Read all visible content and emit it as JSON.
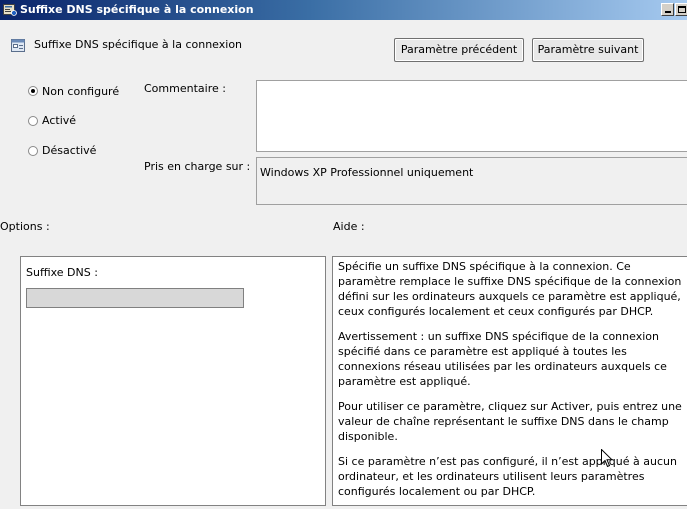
{
  "window": {
    "title": "Suffixe DNS spécifique à la connexion"
  },
  "header": {
    "setting_name": "Suffixe DNS spécifique à la connexion",
    "prev_button": "Paramètre précédent",
    "next_button": "Paramètre suivant"
  },
  "state": {
    "options": [
      {
        "label": "Non configuré",
        "checked": true
      },
      {
        "label": "Activé",
        "checked": false
      },
      {
        "label": "Désactivé",
        "checked": false
      }
    ]
  },
  "comment": {
    "label": "Commentaire :",
    "value": ""
  },
  "supported": {
    "label": "Pris en charge sur :",
    "value": "Windows XP Professionnel uniquement"
  },
  "options_section": {
    "label": "Options :",
    "field_label": "Suffixe DNS :",
    "field_value": ""
  },
  "help_section": {
    "label": "Aide :",
    "paragraphs": [
      "Spécifie un suffixe DNS spécifique à la connexion. Ce paramètre remplace le suffixe DNS spécifique de la connexion défini sur les ordinateurs auxquels ce paramètre est appliqué, ceux configurés localement et ceux configurés par DHCP.",
      "Avertissement : un suffixe DNS spécifique de la connexion spécifié dans ce paramètre est appliqué à toutes les connexions réseau utilisées par les ordinateurs auxquels ce paramètre est appliqué.",
      "Pour utiliser ce paramètre, cliquez sur Activer, puis entrez une valeur de chaîne représentant le suffixe DNS dans le champ disponible.",
      "Si ce paramètre n’est pas configuré, il n’est appliqué à aucun ordinateur, et les ordinateurs utilisent leurs paramètres configurés localement ou par DHCP."
    ]
  }
}
